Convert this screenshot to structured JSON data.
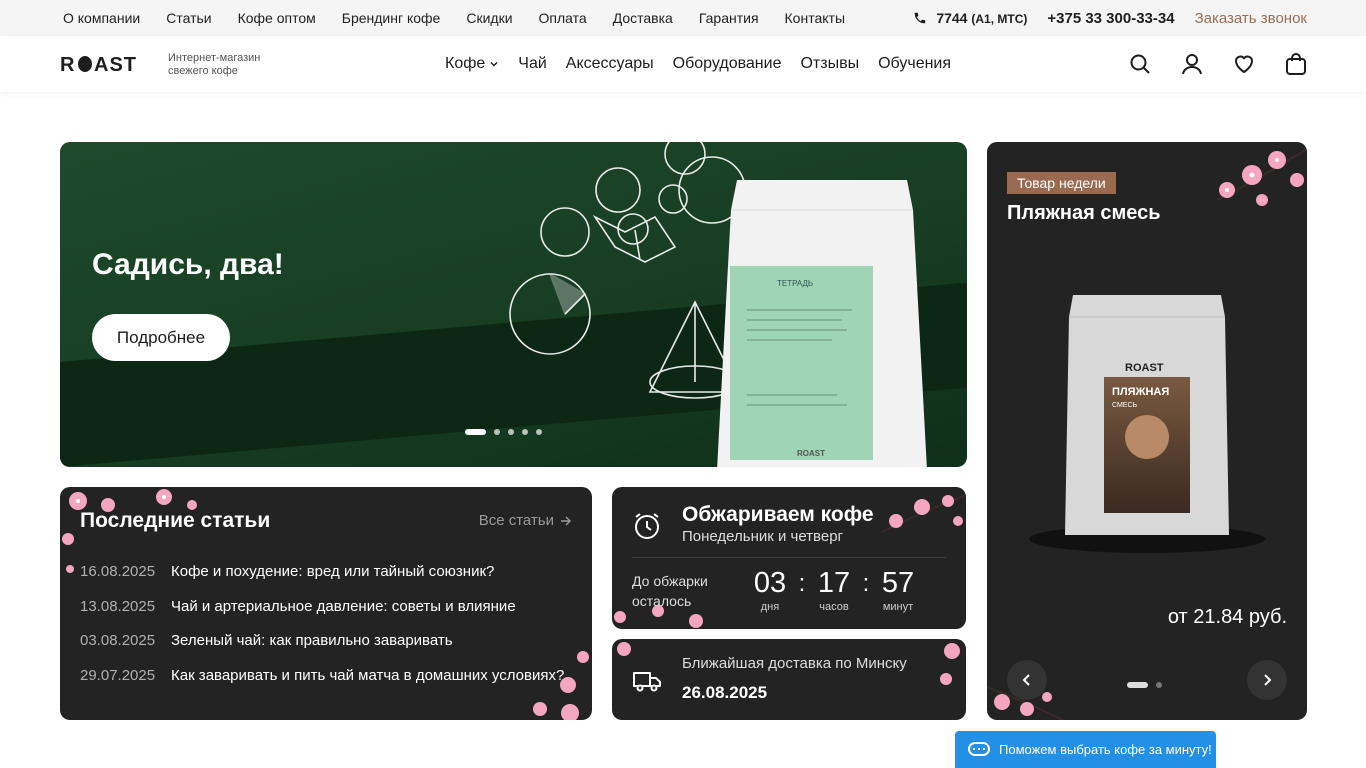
{
  "topbar": {
    "links": [
      "О компании",
      "Статьи",
      "Кофе оптом",
      "Брендинг кофе",
      "Скидки",
      "Оплата",
      "Доставка",
      "Гарантия",
      "Контакты"
    ],
    "short_phone": "7744",
    "short_phone_note": "(A1, МТС)",
    "phone": "+375 33 300-33-34",
    "callback": "Заказать звонок"
  },
  "header": {
    "logo_alt": "ROAST",
    "tagline_line1": "Интернет-магазин",
    "tagline_line2": "свежего кофе",
    "nav": [
      "Кофе",
      "Чай",
      "Аксессуары",
      "Оборудование",
      "Отзывы",
      "Обучения"
    ],
    "icons": [
      "search-icon",
      "user-icon",
      "heart-icon",
      "cart-icon"
    ]
  },
  "hero": {
    "title": "Садись, два!",
    "button_label": "Подробнее",
    "bag_label": "ТЕТРАДЬ",
    "bag_brand": "ROAST",
    "slides_total": 5,
    "active_slide": 1
  },
  "product_of_week": {
    "badge": "Товар недели",
    "name": "Пляжная смесь",
    "bag_brand": "ROAST",
    "bag_title": "ПЛЯЖНАЯ",
    "bag_subtitle": "СМЕСЬ",
    "price": "от 21.84 руб.",
    "slides_total": 2,
    "active_slide": 1
  },
  "articles": {
    "title": "Последние статьи",
    "all_link": "Все статьи",
    "items": [
      {
        "date": "16.08.2025",
        "title": "Кофе и похудение: вред или тайный союзник?"
      },
      {
        "date": "13.08.2025",
        "title": "Чай и артериальное давление: советы и влияние"
      },
      {
        "date": "03.08.2025",
        "title": "Зеленый чай: как правильно заваривать"
      },
      {
        "date": "29.07.2025",
        "title": "Как заваривать и пить чай матча в домашних условиях?"
      }
    ]
  },
  "roasting": {
    "title": "Обжариваем кофе",
    "days": "Понедельник и четверг",
    "until_label": "До обжарки осталось",
    "days_value": "03",
    "days_unit": "дня",
    "hours_value": "17",
    "hours_unit": "часов",
    "minutes_value": "57",
    "minutes_unit": "минут"
  },
  "delivery": {
    "label": "Ближайшая доставка по Минску",
    "date": "26.08.2025"
  },
  "chat": {
    "label": "Поможем выбрать кофе за минуту!"
  },
  "colors": {
    "accent": "#9c6f55",
    "card_bg": "#232323",
    "hero_green": "#1e4a2a",
    "chat_blue": "#2390e8",
    "blossom": "#f4a6c0"
  }
}
